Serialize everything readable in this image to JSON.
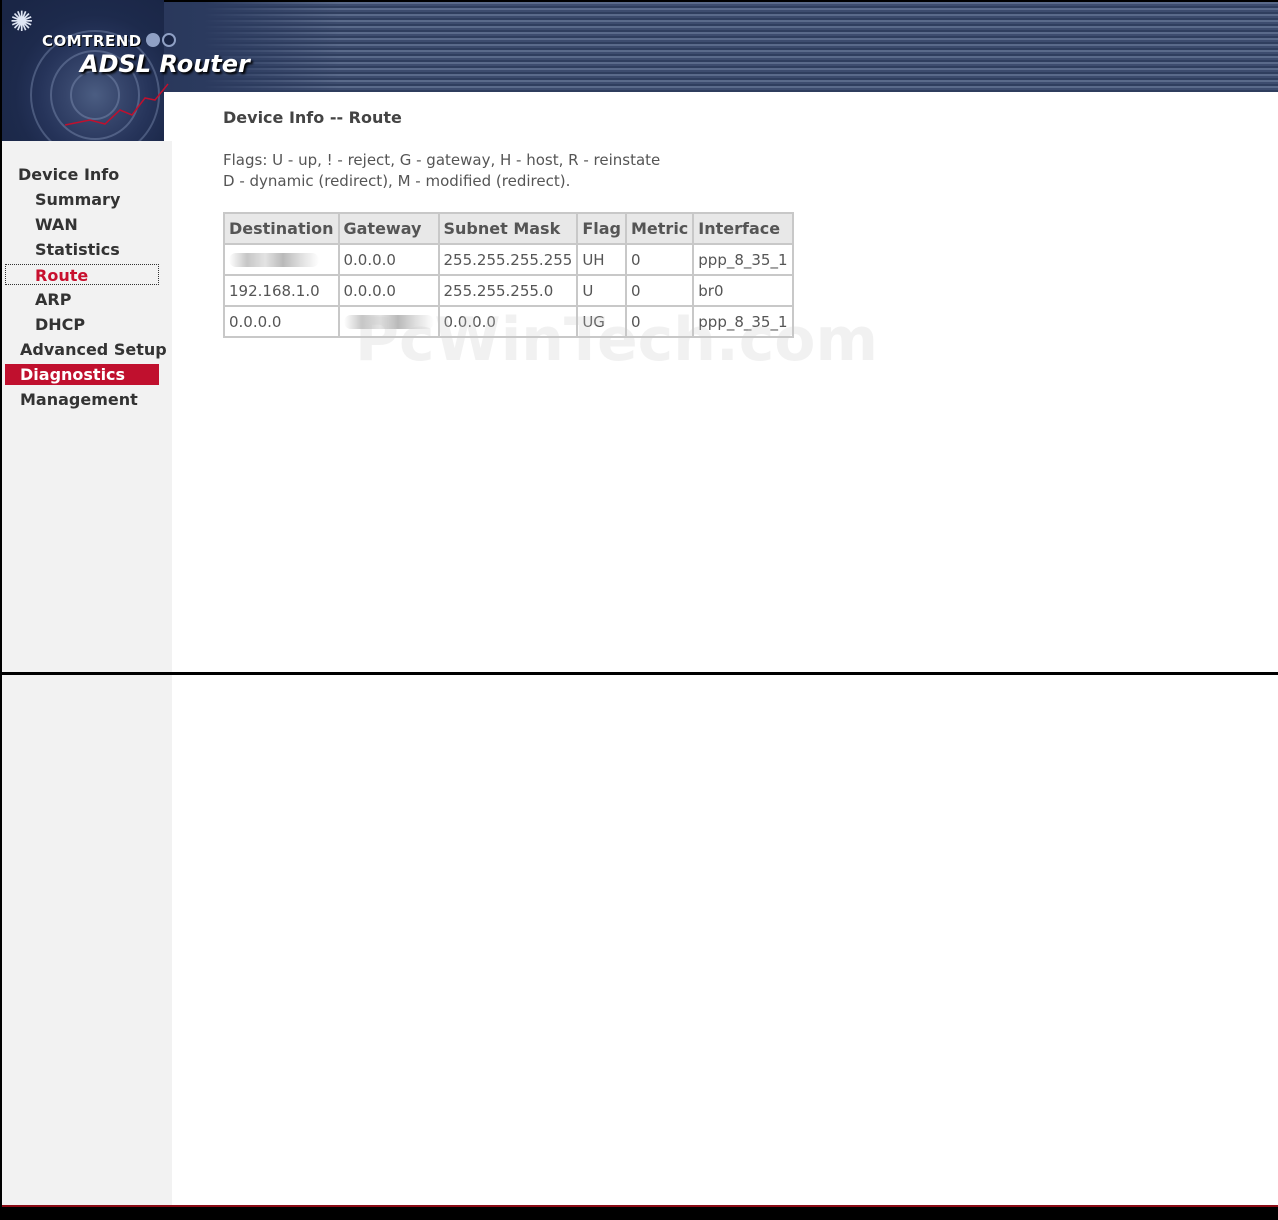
{
  "banner": {
    "brand": "COMTREND",
    "product": "ADSL Router"
  },
  "sidebar": {
    "items": [
      {
        "label": "Device Info",
        "level": "top",
        "active": false
      },
      {
        "label": "Summary",
        "level": "sub",
        "active": false
      },
      {
        "label": "WAN",
        "level": "sub",
        "active": false
      },
      {
        "label": "Statistics",
        "level": "sub",
        "active": false
      },
      {
        "label": "Route",
        "level": "sub",
        "active": true
      },
      {
        "label": "ARP",
        "level": "sub",
        "active": false
      },
      {
        "label": "DHCP",
        "level": "sub",
        "active": false
      },
      {
        "label": "Advanced Setup",
        "level": "top",
        "active": false
      },
      {
        "label": "Diagnostics",
        "level": "top",
        "active": true
      },
      {
        "label": "Management",
        "level": "top",
        "active": false
      }
    ]
  },
  "main": {
    "title": "Device Info -- Route",
    "flags_line1": "Flags: U - up, ! - reject, G - gateway, H - host, R - reinstate",
    "flags_line2": "D - dynamic (redirect), M - modified (redirect).",
    "table": {
      "headers": [
        "Destination",
        "Gateway",
        "Subnet Mask",
        "Flag",
        "Metric",
        "Interface"
      ],
      "rows": [
        [
          "",
          "0.0.0.0",
          "255.255.255.255",
          "UH",
          "0",
          "ppp_8_35_1"
        ],
        [
          "192.168.1.0",
          "0.0.0.0",
          "255.255.255.0",
          "U",
          "0",
          "br0"
        ],
        [
          "0.0.0.0",
          "",
          "0.0.0.0",
          "UG",
          "0",
          "ppp_8_35_1"
        ]
      ],
      "redacted_cells": [
        [
          0,
          0
        ],
        [
          2,
          1
        ]
      ]
    }
  },
  "watermark": "PcWinTech.com",
  "colors": {
    "accent_red": "#c0102e",
    "sidebar_bg": "#f2f2f2",
    "banner_navy": "#2f3e5e"
  }
}
